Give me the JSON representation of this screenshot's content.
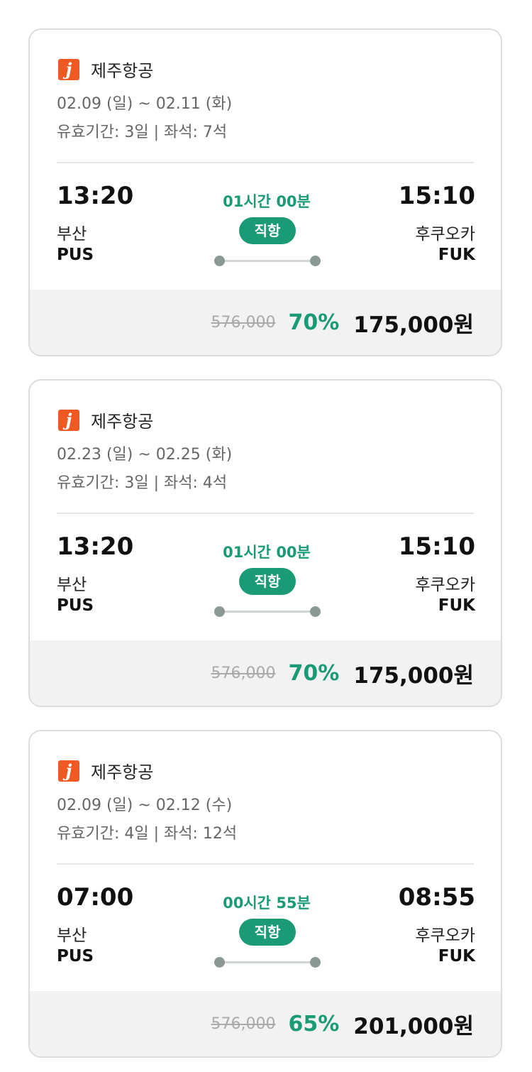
{
  "flights": [
    {
      "airline": "제주항공",
      "logo_letter": "j",
      "dates": "02.09 (일) ~ 02.11 (화)",
      "validity": "유효기간: 3일 | 좌석: 7석",
      "departure": {
        "time": "13:20",
        "city": "부산",
        "code": "PUS"
      },
      "arrival": {
        "time": "15:10",
        "city": "후쿠오카",
        "code": "FUK"
      },
      "duration": "01시간 00분",
      "flight_type": "직항",
      "original_price": "576,000",
      "discount": "70%",
      "price": "175,000원"
    },
    {
      "airline": "제주항공",
      "logo_letter": "j",
      "dates": "02.23 (일) ~ 02.25 (화)",
      "validity": "유효기간: 3일 | 좌석: 4석",
      "departure": {
        "time": "13:20",
        "city": "부산",
        "code": "PUS"
      },
      "arrival": {
        "time": "15:10",
        "city": "후쿠오카",
        "code": "FUK"
      },
      "duration": "01시간 00분",
      "flight_type": "직항",
      "original_price": "576,000",
      "discount": "70%",
      "price": "175,000원"
    },
    {
      "airline": "제주항공",
      "logo_letter": "j",
      "dates": "02.09 (일) ~ 02.12 (수)",
      "validity": "유효기간: 4일 | 좌석: 12석",
      "departure": {
        "time": "07:00",
        "city": "부산",
        "code": "PUS"
      },
      "arrival": {
        "time": "08:55",
        "city": "후쿠오카",
        "code": "FUK"
      },
      "duration": "00시간 55분",
      "flight_type": "직항",
      "original_price": "576,000",
      "discount": "65%",
      "price": "201,000원"
    }
  ],
  "colors": {
    "accent_green": "#1b9a76",
    "logo_orange": "#f05a22",
    "price_bar_bg": "#f2f2f2"
  },
  "icons": {
    "airline_logo": "jeju-air-logo-icon",
    "route": "route-line-icon"
  }
}
